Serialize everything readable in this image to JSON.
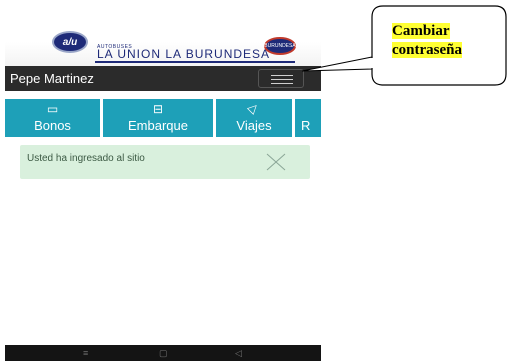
{
  "header": {
    "brand_small": "AUTOBUSES",
    "brand_name": "LA UNION LA BURUNDESA",
    "logo_left_text": "a/u",
    "logo_right_text": "BURUNDESA",
    "user_name": "Pepe Martinez"
  },
  "tabs": [
    {
      "label": "Bonos",
      "icon": "card-icon",
      "glyph": "▭"
    },
    {
      "label": "Embarque",
      "icon": "bus-icon",
      "glyph": "⊟"
    },
    {
      "label": "Viajes",
      "icon": "send-icon",
      "glyph": "◁"
    },
    {
      "label": "R",
      "icon": "",
      "glyph": ""
    }
  ],
  "alert": {
    "message": "Usted ha ingresado al sitio"
  },
  "annotation": {
    "line1": "Cambiar",
    "line2": "contraseña"
  },
  "colors": {
    "tab_bg": "#1ea0b8",
    "navbar_bg": "#2b2b2b",
    "alert_bg": "#d9f0dd",
    "brand": "#1e2a78",
    "highlight": "#ffff33"
  }
}
